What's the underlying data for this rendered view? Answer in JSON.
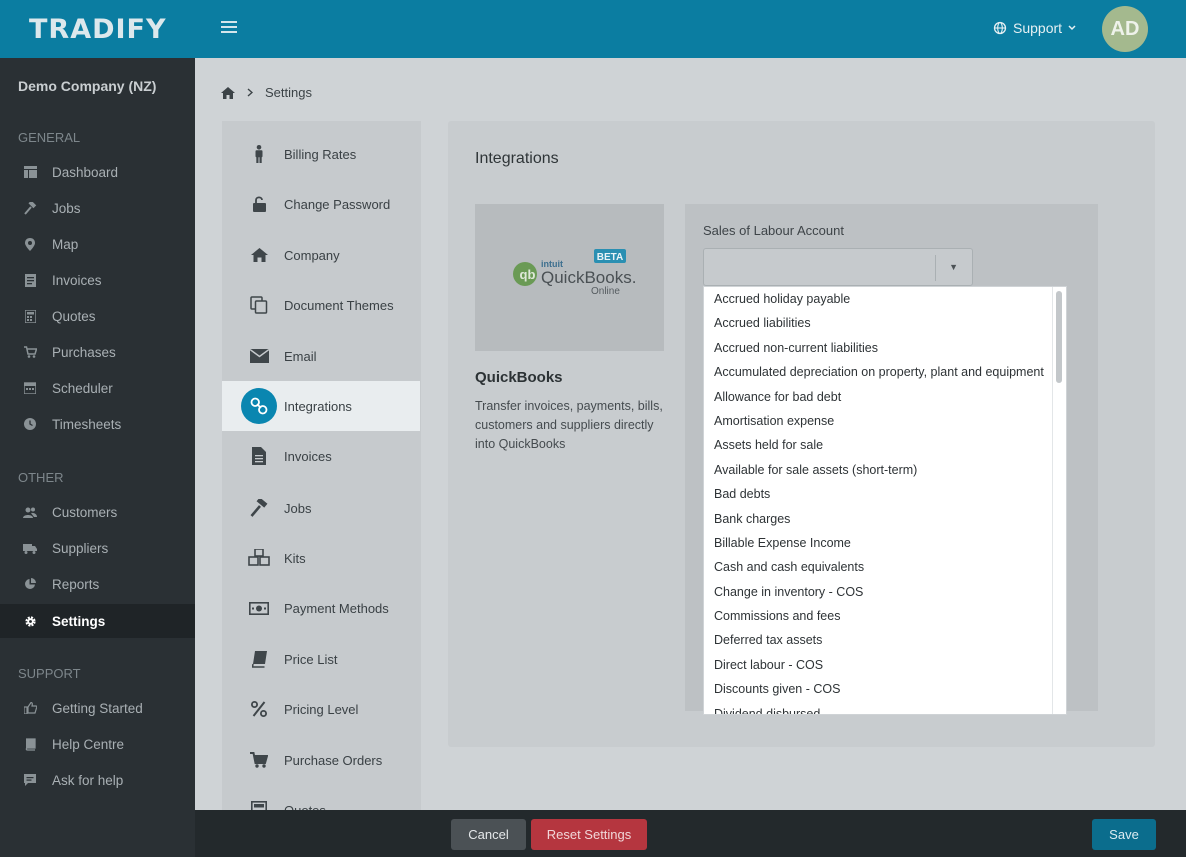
{
  "app": {
    "logo": "TRADIFY"
  },
  "header": {
    "support_label": "Support",
    "avatar_initials": "AD"
  },
  "sidebar": {
    "company": "Demo Company (NZ)",
    "sections": [
      {
        "heading": "GENERAL",
        "items": [
          {
            "label": "Dashboard",
            "icon": "dashboard-icon"
          },
          {
            "label": "Jobs",
            "icon": "hammer-icon"
          },
          {
            "label": "Map",
            "icon": "map-pin-icon"
          },
          {
            "label": "Invoices",
            "icon": "invoice-icon"
          },
          {
            "label": "Quotes",
            "icon": "calculator-icon"
          },
          {
            "label": "Purchases",
            "icon": "cart-icon"
          },
          {
            "label": "Scheduler",
            "icon": "calendar-icon"
          },
          {
            "label": "Timesheets",
            "icon": "clock-icon"
          }
        ]
      },
      {
        "heading": "OTHER",
        "items": [
          {
            "label": "Customers",
            "icon": "users-icon"
          },
          {
            "label": "Suppliers",
            "icon": "truck-icon"
          },
          {
            "label": "Reports",
            "icon": "pie-chart-icon"
          },
          {
            "label": "Settings",
            "icon": "gear-icon",
            "active": true
          }
        ]
      },
      {
        "heading": "SUPPORT",
        "items": [
          {
            "label": "Getting Started",
            "icon": "thumbs-up-icon"
          },
          {
            "label": "Help Centre",
            "icon": "book-icon"
          },
          {
            "label": "Ask for help",
            "icon": "chat-icon"
          }
        ]
      }
    ]
  },
  "breadcrumb": {
    "current": "Settings"
  },
  "settings_menu": [
    {
      "label": "Billing Rates"
    },
    {
      "label": "Change Password"
    },
    {
      "label": "Company"
    },
    {
      "label": "Document Themes"
    },
    {
      "label": "Email"
    },
    {
      "label": "Integrations",
      "active": true
    },
    {
      "label": "Invoices"
    },
    {
      "label": "Jobs"
    },
    {
      "label": "Kits"
    },
    {
      "label": "Payment Methods"
    },
    {
      "label": "Price List"
    },
    {
      "label": "Pricing Level"
    },
    {
      "label": "Purchase Orders"
    },
    {
      "label": "Quotes"
    }
  ],
  "integrations": {
    "title": "Integrations",
    "badge": "BETA",
    "logo_intuit": "intuit",
    "logo_main": "QuickBooks.",
    "logo_sub": "Online",
    "name": "QuickBooks",
    "description": "Transfer invoices, payments, bills, customers and suppliers directly into QuickBooks",
    "field_label": "Sales of Labour Account",
    "selected_value": ""
  },
  "dropdown_options": [
    "Accrued holiday payable",
    "Accrued liabilities",
    "Accrued non-current liabilities",
    "Accumulated depreciation on property, plant and equipment",
    "Allowance for bad debt",
    "Amortisation expense",
    "Assets held for sale",
    "Available for sale assets (short-term)",
    "Bad debts",
    "Bank charges",
    "Billable Expense Income",
    "Cash and cash equivalents",
    "Change in inventory - COS",
    "Commissions and fees",
    "Deferred tax assets",
    "Direct labour - COS",
    "Discounts given - COS",
    "Dividend disbursed"
  ],
  "footer": {
    "cancel": "Cancel",
    "reset": "Reset Settings",
    "save": "Save"
  },
  "colors": {
    "brand": "#0b7da1",
    "danger": "#b5363f",
    "save": "#0b6d8d"
  }
}
